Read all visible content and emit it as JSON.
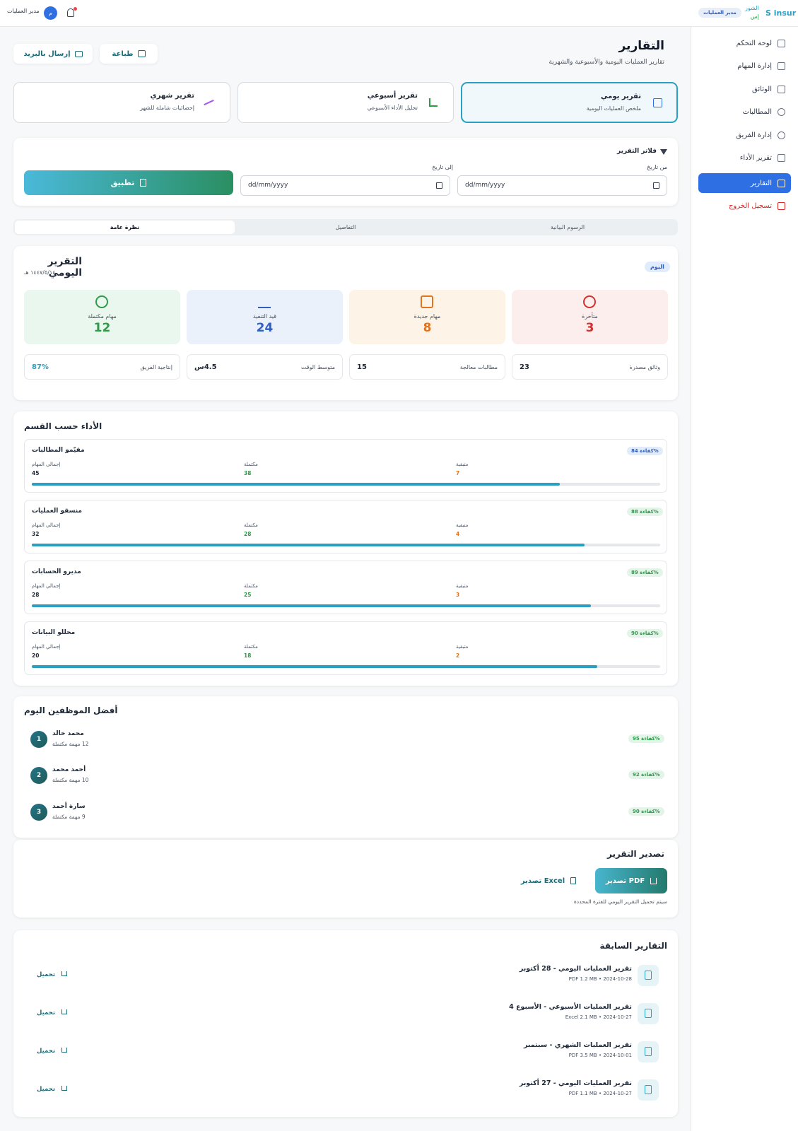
{
  "header": {
    "brand_logo": "S insur",
    "brand_name_line1": "الشور",
    "brand_name_line2": "إس",
    "role_badge": "مدير العمليات",
    "user_name": "مدير العمليات",
    "avatar_letter": "م",
    "notification_color": "#ef4444"
  },
  "sidebar": {
    "items": [
      {
        "label": "لوحة التحكم",
        "icon": "grid-icon"
      },
      {
        "label": "إدارة المهام",
        "icon": "clipboard-icon"
      },
      {
        "label": "الوثائق",
        "icon": "document-icon"
      },
      {
        "label": "المطالبات",
        "icon": "alert-circle-icon"
      },
      {
        "label": "إدارة الفريق",
        "icon": "users-icon"
      },
      {
        "label": "تقرير الأداء",
        "icon": "bar-chart-icon"
      },
      {
        "label": "التقارير",
        "icon": "report-icon",
        "active": true
      }
    ],
    "logout": "تسجيل الخروج"
  },
  "page": {
    "title": "التقارير",
    "subtitle": "تقارير العمليات اليومية والأسبوعية والشهرية",
    "print_label": "طباعة",
    "email_label": "إرسال بالبريد"
  },
  "report_types": [
    {
      "title": "تقرير يومي",
      "desc": "ملخص العمليات اليومية",
      "selected": true
    },
    {
      "title": "تقرير أسبوعي",
      "desc": "تحليل الأداء الأسبوعي"
    },
    {
      "title": "تقرير شهري",
      "desc": "إحصائيات شاملة للشهر"
    }
  ],
  "filters": {
    "title": "فلاتر التقرير",
    "from_label": "من تاريخ",
    "to_label": "إلى تاريخ",
    "from_placeholder": "dd/mm/yyyy",
    "to_placeholder": "dd/mm/yyyy",
    "apply_label": "تطبيق"
  },
  "tabs": [
    "الرسوم البيانية",
    "التفاصيل",
    "نظرة عامة"
  ],
  "daily": {
    "title": "التقرير اليومي",
    "date": "١٤٤٧/٥/١٤ هـ",
    "today_badge": "اليوم",
    "stats": [
      {
        "label": "متأخرة",
        "value": "3",
        "color": "#d32f2f",
        "bg": "#fdeeee"
      },
      {
        "label": "مهام جديدة",
        "value": "8",
        "color": "#e0741f",
        "bg": "#fdf3e6"
      },
      {
        "label": "قيد التنفيذ",
        "value": "24",
        "color": "#2f5fc4",
        "bg": "#eaf1fb"
      },
      {
        "label": "مهام مكتملة",
        "value": "12",
        "color": "#2e9a4a",
        "bg": "#eaf7ee"
      }
    ],
    "mini": [
      {
        "label": "وثائق مصدرة",
        "value": "23"
      },
      {
        "label": "مطالبات معالجة",
        "value": "15"
      },
      {
        "label": "متوسط الوقت",
        "value": "4.5س"
      },
      {
        "label": "إنتاجية الفريق",
        "value": "87%"
      }
    ]
  },
  "departments": {
    "title": "الأداء حسب القسم",
    "total_label": "إجمالي المهام",
    "completed_label": "مكتملة",
    "remaining_label": "متبقية",
    "items": [
      {
        "name": "مقيّمو المطالبات",
        "efficiency": "كفاءة 84%",
        "total": "45",
        "completed": "38",
        "remaining": "7",
        "progress": 0.84,
        "badge_bg": "#e0ecfb",
        "badge_color": "#2f5fc4"
      },
      {
        "name": "منسقو العمليات",
        "efficiency": "كفاءة 88%",
        "total": "32",
        "completed": "28",
        "remaining": "4",
        "progress": 0.88,
        "badge_bg": "#e3f5e8",
        "badge_color": "#2e9a4a"
      },
      {
        "name": "مديرو الحسابات",
        "efficiency": "كفاءة 89%",
        "total": "28",
        "completed": "25",
        "remaining": "3",
        "progress": 0.89,
        "badge_bg": "#e3f5e8",
        "badge_color": "#2e9a4a"
      },
      {
        "name": "محللو البيانات",
        "efficiency": "كفاءة 90%",
        "total": "20",
        "completed": "18",
        "remaining": "2",
        "progress": 0.9,
        "badge_bg": "#e3f5e8",
        "badge_color": "#2e9a4a"
      }
    ]
  },
  "top_employees": {
    "title": "أفضل الموظفين اليوم",
    "items": [
      {
        "rank": "1",
        "name": "محمد خالد",
        "tasks": "12 مهمة مكتملة",
        "efficiency": "كفاءة 95%"
      },
      {
        "rank": "2",
        "name": "أحمد محمد",
        "tasks": "10 مهمة مكتملة",
        "efficiency": "كفاءة 92%"
      },
      {
        "rank": "3",
        "name": "سارة أحمد",
        "tasks": "9 مهمة مكتملة",
        "efficiency": "كفاءة 90%"
      }
    ]
  },
  "export": {
    "title": "تصدير التقرير",
    "pdf_label": "تصدير PDF",
    "excel_label": "تصدير Excel",
    "note": "سيتم تحميل التقرير اليومي للفترة المحددة"
  },
  "previous": {
    "title": "التقارير السابقة",
    "download_label": "تحميل",
    "items": [
      {
        "title": "تقرير العمليات اليومي - 28 أكتوبر",
        "meta": "2024-10-28 • PDF 1.2 MB"
      },
      {
        "title": "تقرير العمليات الأسبوعي - الأسبوع 4",
        "meta": "2024-10-27 • Excel 2.1 MB"
      },
      {
        "title": "تقرير العمليات الشهري - سبتمبر",
        "meta": "2024-10-01 • PDF 3.5 MB"
      },
      {
        "title": "تقرير العمليات اليومي - 27 أكتوبر",
        "meta": "2024-10-27 • PDF 1.1 MB"
      }
    ]
  }
}
